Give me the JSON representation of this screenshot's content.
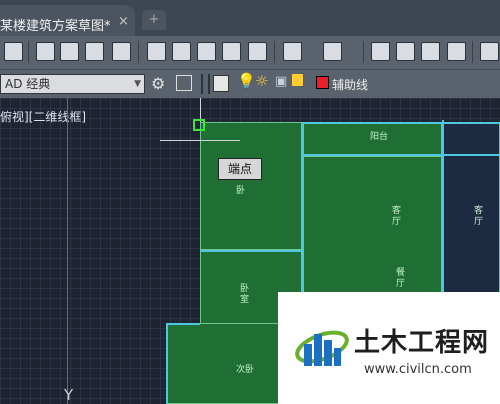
{
  "tab": {
    "title": "某楼建筑方案草图*",
    "close": "×",
    "new_tab": "+"
  },
  "workspace": {
    "value": "AD 经典"
  },
  "layer": {
    "name": "辅助线",
    "color": "#e8202a"
  },
  "viewport": {
    "view_label": "俯视][二维线框]"
  },
  "tooltip": "端点",
  "rooms": {
    "r1": "阳台",
    "r2": "客厅",
    "r3": "客厅",
    "r4": "餐厅",
    "r5": "卧室",
    "r6": "次卧",
    "r7": "卧"
  },
  "ucs_label": "Y",
  "watermark": {
    "main": "土木工程网",
    "url": "www.civilcn.com"
  }
}
